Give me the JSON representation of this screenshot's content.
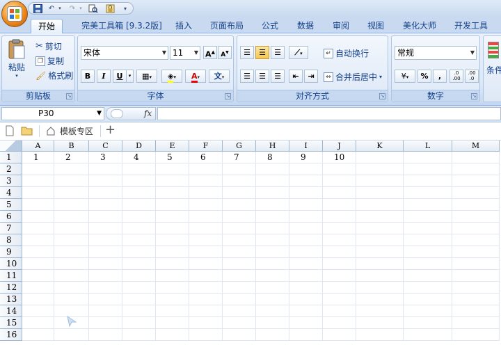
{
  "qat": {
    "undo": "↶",
    "redo": "↷",
    "more": "▾"
  },
  "tabs": [
    {
      "label": "开始",
      "active": true
    },
    {
      "label": "完美工具箱 [9.3.2版]"
    },
    {
      "label": "插入"
    },
    {
      "label": "页面布局"
    },
    {
      "label": "公式"
    },
    {
      "label": "数据"
    },
    {
      "label": "审阅"
    },
    {
      "label": "视图"
    },
    {
      "label": "美化大师"
    },
    {
      "label": "开发工具"
    }
  ],
  "clipboard": {
    "paste": "粘贴",
    "cut": "剪切",
    "copy": "复制",
    "format_painter": "格式刷",
    "group": "剪贴板"
  },
  "font": {
    "name": "宋体",
    "size": "11",
    "bold": "B",
    "italic": "I",
    "underline": "U",
    "grow": "A",
    "shrink": "A",
    "color_letter": "A",
    "phonetic": "文",
    "group": "字体"
  },
  "alignment": {
    "wrap": "自动换行",
    "merge": "合并后居中",
    "group": "对齐方式"
  },
  "number": {
    "format": "常规",
    "percent": "%",
    "comma": ",",
    "inc_dec": ".0 .00",
    "dec_dec": ".00 .0",
    "group": "数字"
  },
  "styles": {
    "cond": "条件"
  },
  "formula": {
    "cell_ref": "P30",
    "fx": "fx",
    "value": ""
  },
  "doc_tabs": {
    "template": "模板专区",
    "add": "+"
  },
  "sheet": {
    "columns": [
      "A",
      "B",
      "C",
      "D",
      "E",
      "F",
      "G",
      "H",
      "I",
      "J",
      "K",
      "L",
      "M"
    ],
    "rows": [
      "1",
      "2",
      "3",
      "4",
      "5",
      "6",
      "7",
      "8",
      "9",
      "10",
      "11",
      "12",
      "13",
      "14",
      "15",
      "16"
    ],
    "row1_values": [
      "1",
      "2",
      "3",
      "4",
      "5",
      "6",
      "7",
      "8",
      "9",
      "10"
    ]
  },
  "colors": {
    "accent": "#15428b",
    "ribbon": "#dde8f6",
    "selected": "#f8c64e"
  }
}
